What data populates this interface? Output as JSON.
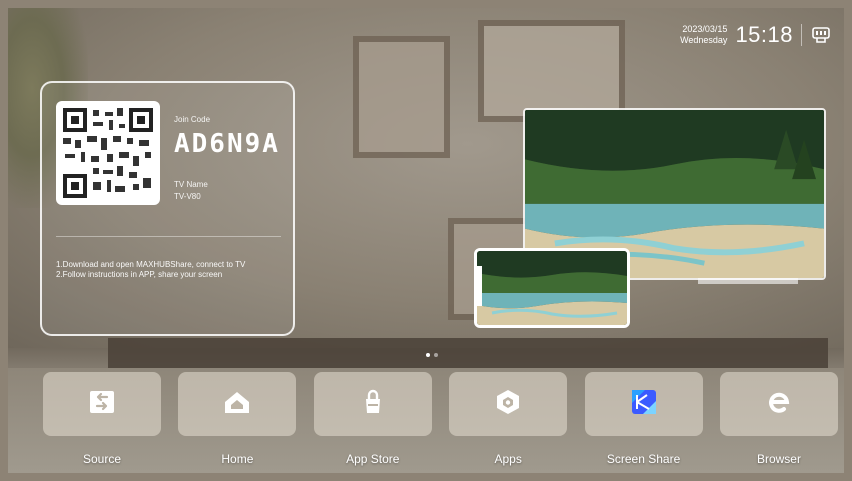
{
  "status": {
    "date": "2023/03/15",
    "weekday": "Wednesday",
    "time": "15:18",
    "icon": "network-icon"
  },
  "share_card": {
    "join_label": "Join Code",
    "join_code": "AD6N9A",
    "tv_name_label": "TV Name",
    "tv_name_value": "TV-V80",
    "instruction_1": "1.Download and open MAXHUBShare, connect to TV",
    "instruction_2": "2.Follow instructions in APP, share your screen"
  },
  "pager": {
    "pages": 2,
    "active": 1
  },
  "dock": {
    "apps": [
      {
        "label": "Source",
        "icon": "source-icon"
      },
      {
        "label": "Home",
        "icon": "home-icon"
      },
      {
        "label": "App Store",
        "icon": "app-store-icon"
      },
      {
        "label": "Apps",
        "icon": "apps-icon"
      },
      {
        "label": "Screen Share",
        "icon": "screen-share-icon"
      },
      {
        "label": "Browser",
        "icon": "browser-icon"
      }
    ]
  },
  "colors": {
    "tile": "#e6ded2",
    "screen_share_icon_a": "#2aa0ff",
    "screen_share_icon_b": "#3b5bff"
  }
}
